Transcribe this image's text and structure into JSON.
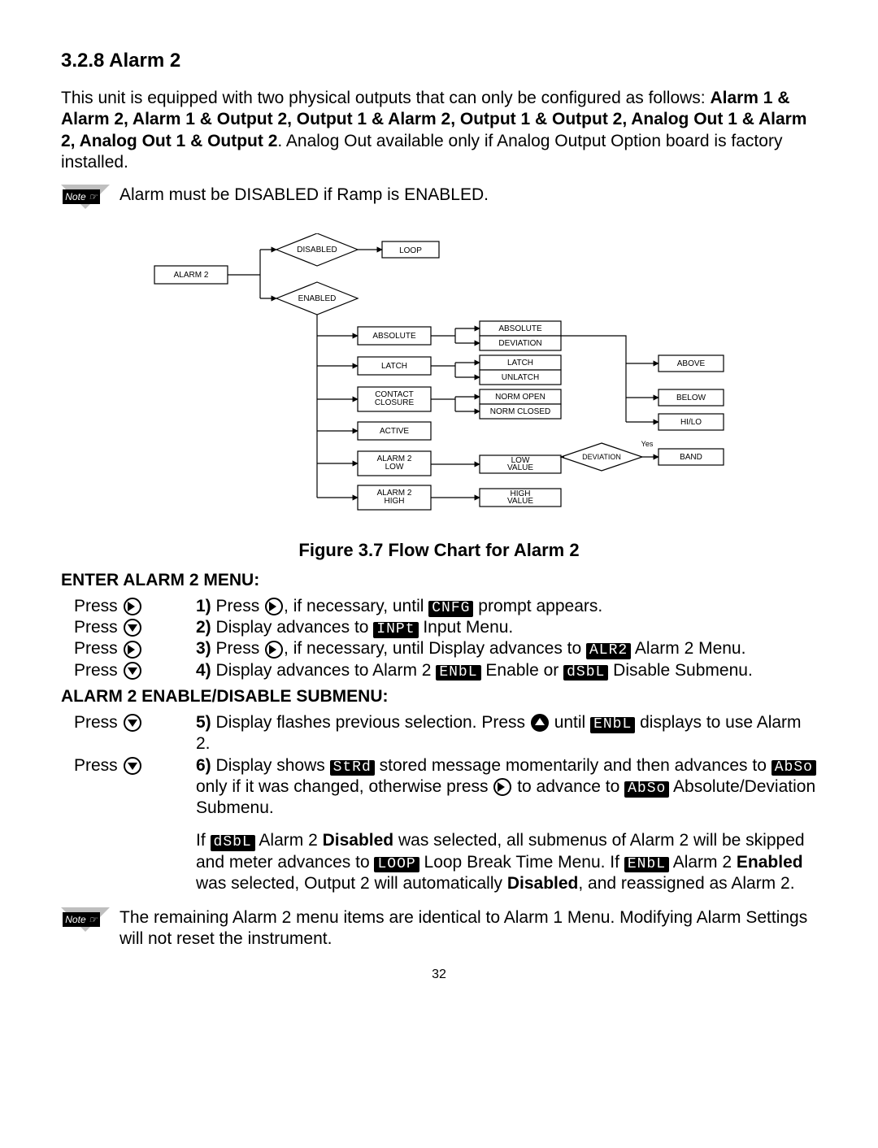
{
  "heading": "3.2.8 Alarm 2",
  "intro": {
    "pre": "This unit is equipped with two physical outputs that can only be configured as follows: ",
    "bold": "Alarm 1 & Alarm 2, Alarm 1 & Output 2, Output 1 & Alarm 2, Output 1 & Output 2, Analog Out 1 & Alarm 2, Analog Out 1 & Output 2",
    "post": ". Analog Out available only if Analog Output Option board is factory installed."
  },
  "note1": "Alarm must be DISABLED if Ramp is ENABLED.",
  "diagram": {
    "root": "ALARM 2",
    "disabled": "DISABLED",
    "enabled": "ENABLED",
    "loop": "LOOP",
    "col1": [
      "ABSOLUTE",
      "LATCH",
      "CONTACT\nCLOSURE",
      "ACTIVE",
      "ALARM 2\nLOW",
      "ALARM 2\nHIGH"
    ],
    "col2": [
      "ABSOLUTE",
      "DEVIATION",
      "LATCH",
      "UNLATCH",
      "NORM OPEN",
      "NORM CLOSED",
      "LOW\nVALUE",
      "HIGH\nVALUE"
    ],
    "deviation_label": "DEVIATION",
    "yes": "Yes",
    "col3": [
      "ABOVE",
      "BELOW",
      "HI/LO",
      "BAND"
    ]
  },
  "figure_caption": "Figure 3.7 Flow Chart for Alarm 2",
  "sec1_head": "ENTER ALARM 2 MENU:",
  "press": "Press",
  "steps1": {
    "s1a": "1)",
    "s1b": " Press ",
    "s1c": ", if necessary, until ",
    "s1seg": "CNFG",
    "s1d": " prompt appears.",
    "s2a": "2)",
    "s2b": " Display advances to ",
    "s2seg": "INPt",
    "s2c": " Input Menu.",
    "s3a": "3)",
    "s3b": " Press ",
    "s3c": ", if necessary, until Display advances to ",
    "s3seg": "ALR2",
    "s3d": " Alarm 2 Menu.",
    "s4a": "4)",
    "s4b": " Display advances to Alarm 2 ",
    "s4seg1": "ENbL",
    "s4c": " Enable or ",
    "s4seg2": "dSbL",
    "s4d": " Disable Submenu."
  },
  "sec2_head": "ALARM 2 ENABLE/DISABLE SUBMENU:",
  "steps2": {
    "s5a": "5)",
    "s5b": " Display flashes previous selection. Press ",
    "s5c": " until ",
    "s5seg": "ENbL",
    "s5d": " displays to use Alarm 2.",
    "s6a": "6)",
    "s6b": " Display shows ",
    "s6seg1": "StRd",
    "s6c": " stored message momentarily and then advances to ",
    "s6seg2": "AbSo",
    "s6d": "  only if it was changed, otherwise press ",
    "s6e": " to advance to ",
    "s6seg3": "AbSo",
    "s6f": "  Absolute/Deviation Submenu."
  },
  "para": {
    "a": "If ",
    "seg1": "dSbL",
    "b": " Alarm 2 ",
    "bold1": "Disabled",
    "c": " was selected, all submenus of Alarm 2 will be skipped and meter advances to ",
    "seg2": "LOOP",
    "d": "  Loop Break Time Menu. If ",
    "seg3": "ENbL",
    "e": " Alarm 2 ",
    "bold2": "Enabled",
    "f": " was selected, Output 2 will automatically ",
    "bold3": "Disabled",
    "g": ", and reassigned as Alarm 2."
  },
  "note2": "The remaining Alarm 2 menu items are identical to Alarm 1 Menu. Modifying Alarm Settings will not reset the instrument.",
  "page": "32",
  "note_label": "Note ☞"
}
